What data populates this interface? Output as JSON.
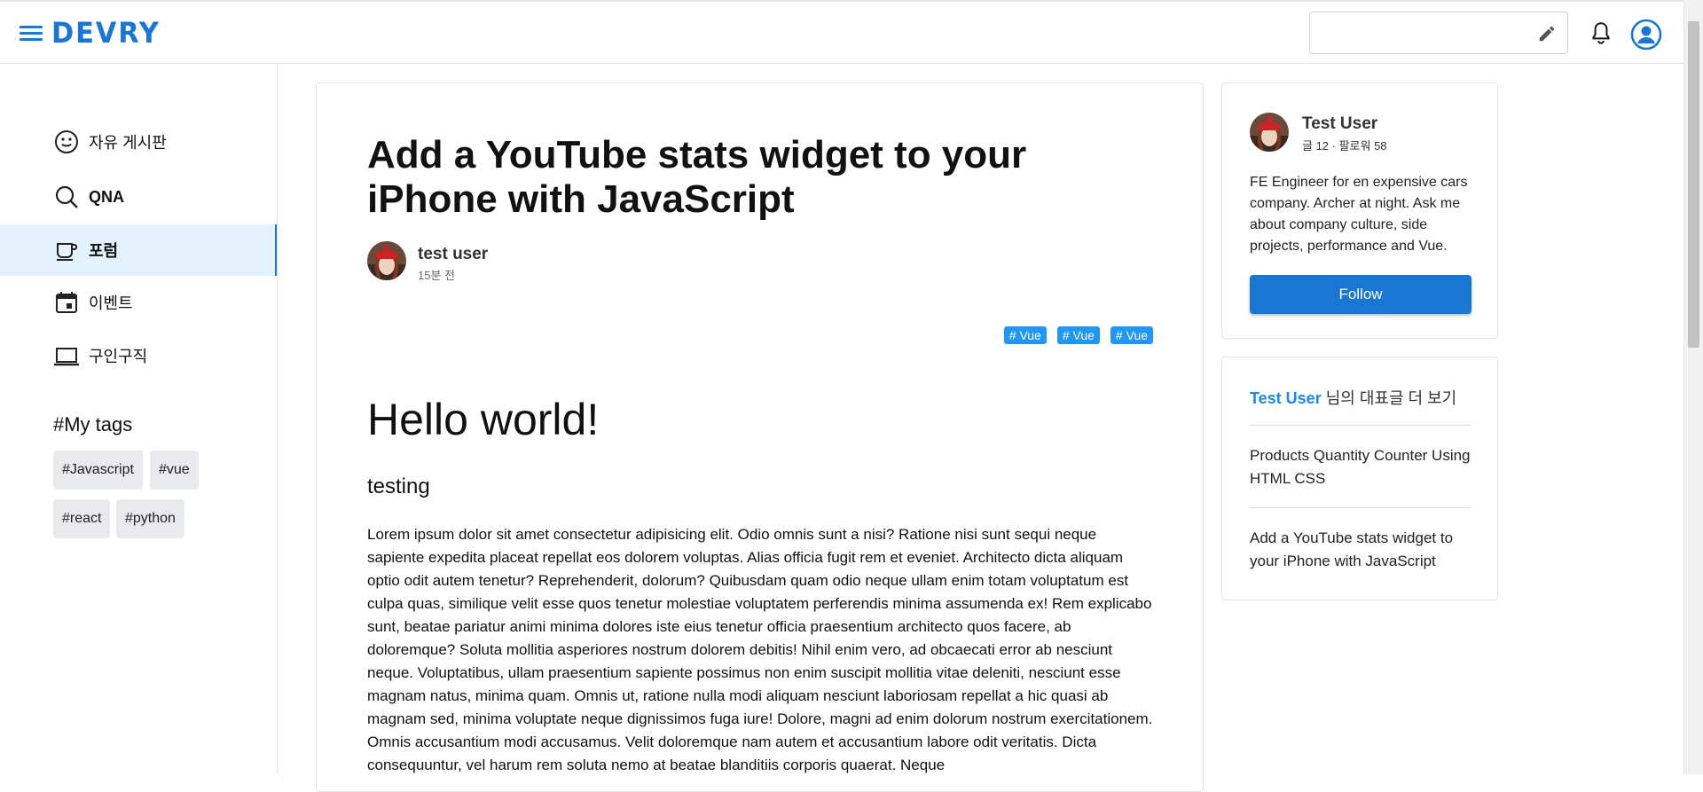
{
  "app": {
    "logo": "DEVRY",
    "brand_color": "#1976d2"
  },
  "header": {
    "search": {
      "value": "",
      "placeholder": ""
    },
    "icons": [
      "menu-icon",
      "pencil-icon",
      "bell-icon",
      "account-icon"
    ]
  },
  "sidebar": {
    "items": [
      {
        "label": "자유 게시판",
        "icon": "smile-icon",
        "active": false
      },
      {
        "label": "QNA",
        "icon": "search-icon",
        "active": false
      },
      {
        "label": "포럼",
        "icon": "coffee-icon",
        "active": true
      },
      {
        "label": "이벤트",
        "icon": "calendar-icon",
        "active": false
      },
      {
        "label": "구인구직",
        "icon": "laptop-icon",
        "active": false
      }
    ],
    "tags_title": "#My tags",
    "tags": [
      "#Javascript",
      "#vue",
      "#react",
      "#python"
    ]
  },
  "article": {
    "title": "Add a YouTube stats widget to your iPhone with JavaScript",
    "author": "test user",
    "time": "15분 전",
    "tags": [
      "# Vue",
      "# Vue",
      "# Vue"
    ],
    "heading": "Hello world!",
    "subheading": "testing",
    "body": "Lorem ipsum dolor sit amet consectetur adipisicing elit. Odio omnis sunt a nisi? Ratione nisi sunt sequi neque sapiente expedita placeat repellat eos dolorem voluptas. Alias officia fugit rem et eveniet. Architecto dicta aliquam optio odit autem tenetur? Reprehenderit, dolorum? Quibusdam quam odio neque ullam enim totam voluptatum est culpa quas, similique velit esse quos tenetur molestiae voluptatem perferendis minima assumenda ex! Rem explicabo sunt, beatae pariatur animi minima dolores iste eius tenetur officia praesentium architecto quos facere, ab doloremque? Soluta mollitia asperiores nostrum dolorem debitis! Nihil enim vero, ad obcaecati error ab nesciunt neque. Voluptatibus, ullam praesentium sapiente possimus non enim suscipit mollitia vitae deleniti, nesciunt esse magnam natus, minima quam. Omnis ut, ratione nulla modi aliquam nesciunt laboriosam repellat a hic quasi ab magnam sed, minima voluptate neque dignissimos fuga iure! Dolore, magni ad enim dolorum nostrum exercitationem. Omnis accusantium modi accusamus. Velit doloremque nam autem et accusantium labore odit veritatis. Dicta consequuntur, vel harum rem soluta nemo at beatae blanditiis corporis quaerat. Neque"
  },
  "profile": {
    "name": "Test User",
    "stats": "글 12 · 팔로워 58",
    "bio": "FE Engineer for en expensive cars company. Archer at night. Ask me about company culture, side projects, performance and Vue.",
    "follow_label": "Follow"
  },
  "more": {
    "user": "Test User",
    "suffix": " 님의 대표글 더 보기",
    "posts": [
      "Products Quantity Counter Using HTML CSS",
      "Add a YouTube stats widget to your iPhone with JavaScript"
    ]
  }
}
